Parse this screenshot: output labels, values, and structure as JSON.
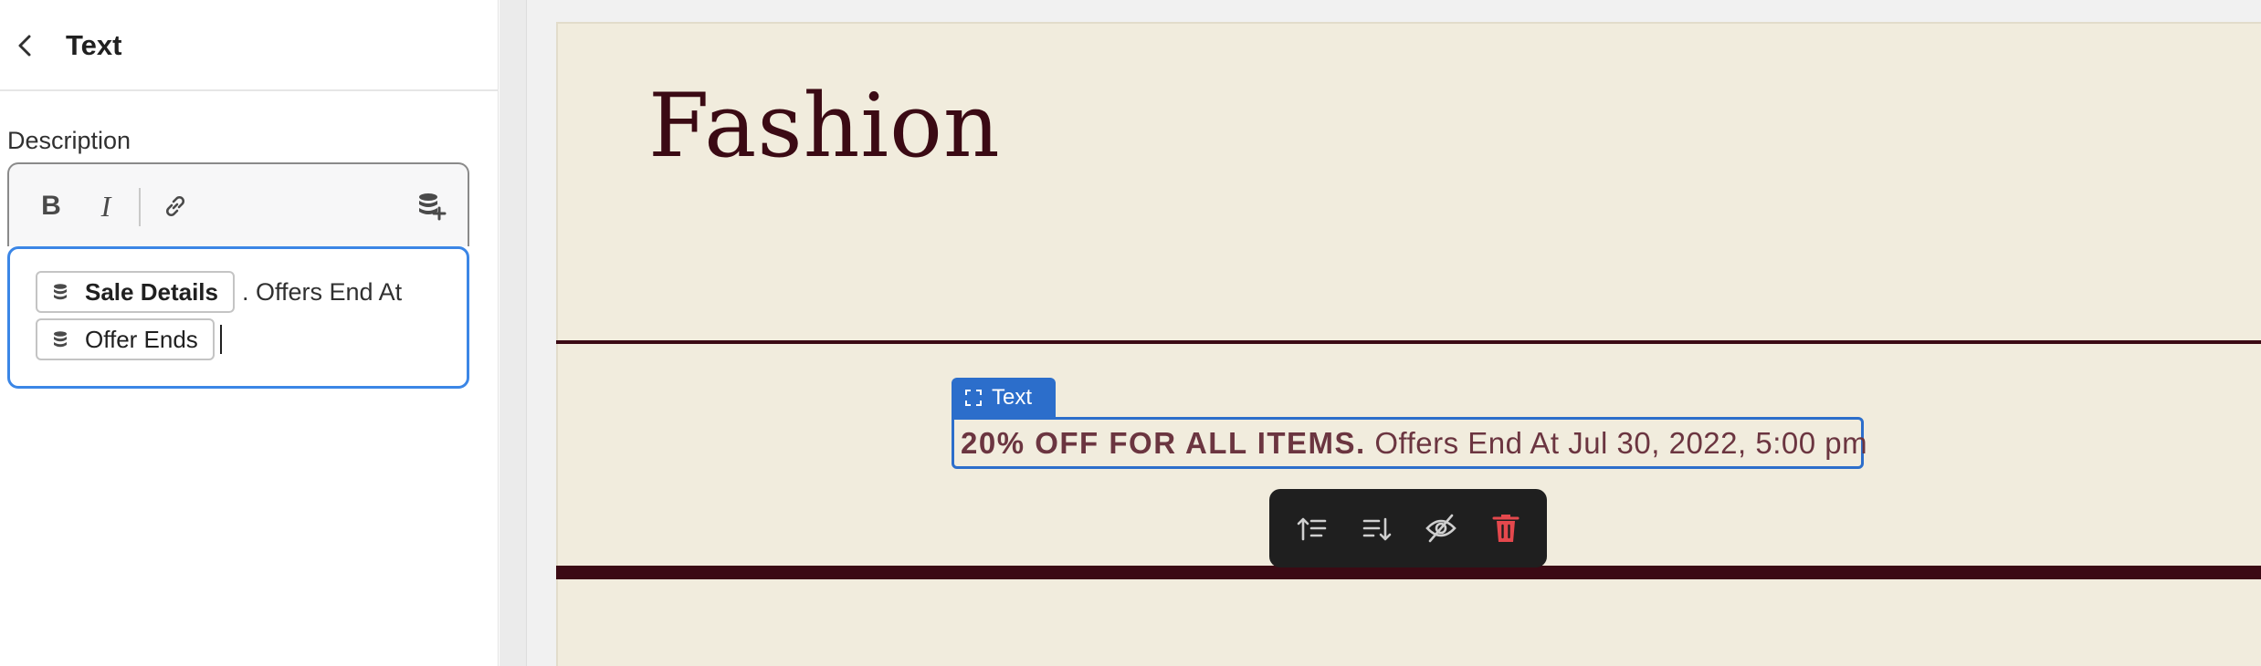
{
  "panel": {
    "title": "Text",
    "field_label": "Description",
    "toolbar": {
      "bold_label": "B",
      "italic_label": "I",
      "link_icon": "link-icon",
      "dynamic_source_icon": "database-add-icon"
    },
    "content": {
      "chip_1": "Sale Details",
      "text_1": ". Offers End At",
      "chip_2": "Offer Ends"
    }
  },
  "canvas": {
    "brand": "Fashion",
    "selection_tag": "Text",
    "promo_bold": "20% OFF FOR ALL ITEMS.",
    "promo_rest": " Offers End At Jul 30, 2022, 5:00 pm",
    "floating_toolbar": [
      {
        "name": "move-up-icon"
      },
      {
        "name": "move-down-icon"
      },
      {
        "name": "hide-icon"
      },
      {
        "name": "delete-icon"
      }
    ]
  },
  "colors": {
    "accent": "#2c6ecb",
    "page_bg": "#f1ecdd",
    "brand_text": "#3b0a14",
    "promo_text": "#6b3540",
    "delete": "#e5484d"
  }
}
